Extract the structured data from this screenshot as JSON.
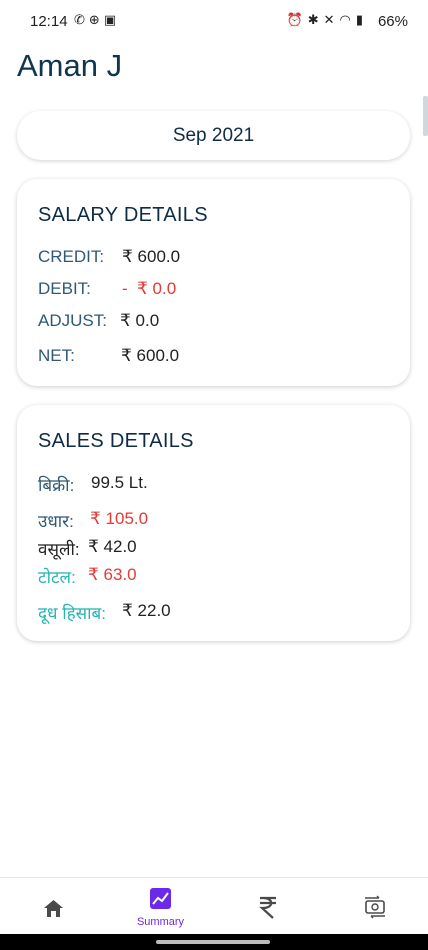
{
  "status_bar": {
    "time": "12:14",
    "left_icons": [
      "whatsapp-icon",
      "game-icon",
      "app-icon"
    ],
    "right_icons": [
      "alarm-icon",
      "bluetooth-icon",
      "mute-icon",
      "wifi-icon",
      "signal-icon"
    ],
    "battery": "66%"
  },
  "header": {
    "name": "Aman J"
  },
  "month": {
    "label": "Sep 2021"
  },
  "salary": {
    "title": "SALARY DETAILS",
    "credit_label": "CREDIT:",
    "credit_value": "₹ 600.0",
    "debit_label": "DEBIT:",
    "debit_minus": "-",
    "debit_value": "₹ 0.0",
    "adjust_label": "ADJUST:",
    "adjust_value": "₹ 0.0",
    "net_label": "NET:",
    "net_value": "₹ 600.0"
  },
  "sales": {
    "title": "SALES DETAILS",
    "bikri_label": "बिक्री:",
    "bikri_value": "99.5 Lt.",
    "udhar_label": "उधार:",
    "udhar_value": "₹ 105.0",
    "vasooli_label": "वसूली:",
    "vasooli_value": "₹ 42.0",
    "total_label": "टोटल:",
    "total_value": "₹ 63.0",
    "milk_label": "दूध हिसाब:",
    "milk_value": "₹ 22.0"
  },
  "nav": {
    "summary_label": "Summary"
  },
  "colors": {
    "accent": "#6a2ae8",
    "red": "#e53935",
    "teal": "#26b3b3",
    "heading": "#0f2c46"
  }
}
